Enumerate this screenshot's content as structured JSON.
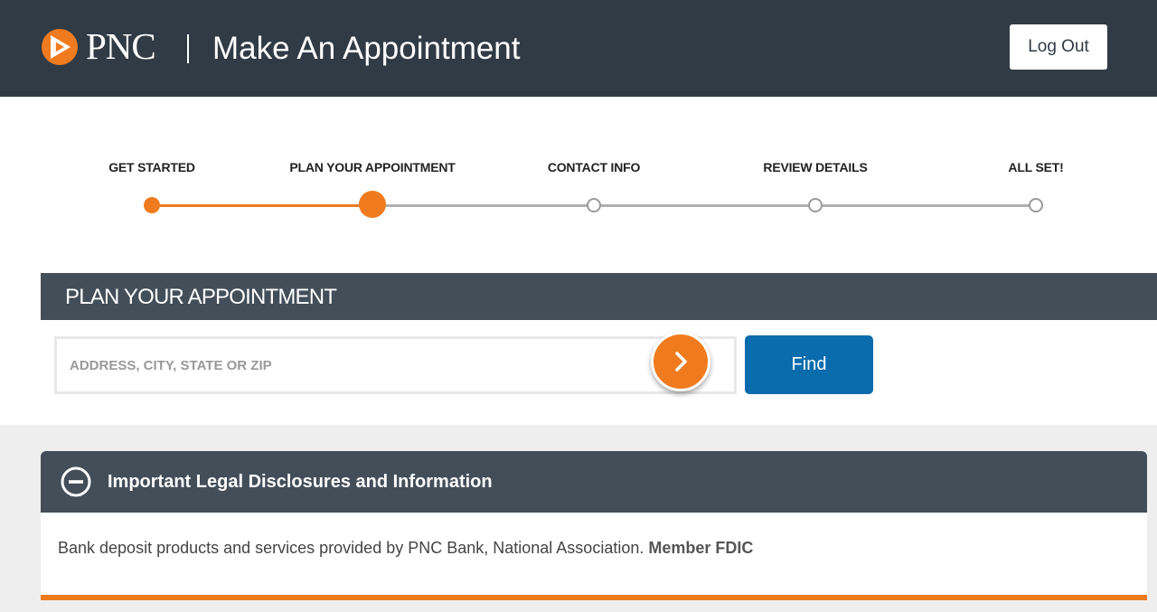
{
  "header": {
    "brand": "PNC",
    "title": "Make An Appointment",
    "logout_label": "Log Out"
  },
  "colors": {
    "header_bg": "#313b45",
    "section_bg": "#434e59",
    "accent_orange": "#ef7b1e",
    "find_blue": "#0a6cad",
    "inactive_gray": "#aaaaaa"
  },
  "progress": {
    "steps": [
      {
        "label": "GET STARTED",
        "state": "completed"
      },
      {
        "label": "PLAN YOUR APPOINTMENT",
        "state": "current"
      },
      {
        "label": "CONTACT INFO",
        "state": "upcoming"
      },
      {
        "label": "REVIEW DETAILS",
        "state": "upcoming"
      },
      {
        "label": "ALL SET!",
        "state": "upcoming"
      }
    ]
  },
  "plan": {
    "section_title": "PLAN YOUR APPOINTMENT",
    "search": {
      "value": "",
      "placeholder": "ADDRESS, CITY, STATE OR ZIP",
      "go_icon": "chevron-right-icon"
    },
    "find_label": "Find"
  },
  "disclosures": {
    "title": "Important Legal Disclosures and Information",
    "toggle_icon": "minus-circle-icon",
    "text": "Bank deposit products and services provided by PNC Bank, National Association.",
    "bold_text": "Member FDIC"
  }
}
